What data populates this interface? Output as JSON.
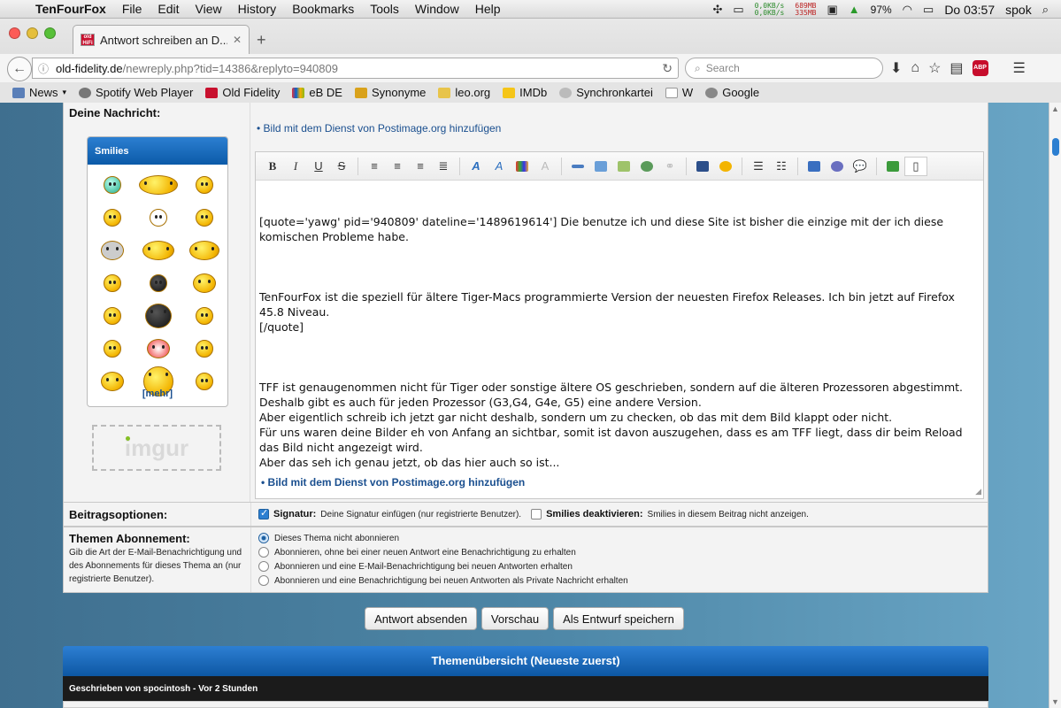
{
  "menubar": {
    "app_name": "TenFourFox",
    "items": [
      "File",
      "Edit",
      "View",
      "History",
      "Bookmarks",
      "Tools",
      "Window",
      "Help"
    ],
    "net_up": "0,0KB/s",
    "net_down": "0,0KB/s",
    "mem_used": "689MB",
    "mem_free": "335MB",
    "battery": "97%",
    "clock": "Do 03:57",
    "user": "spok"
  },
  "tab": {
    "favicon_text": "old HiFi",
    "title": "Antwort schreiben an D..."
  },
  "url": {
    "host": "old-fidelity.de",
    "path": "/newreply.php?tid=14386&replyto=940809"
  },
  "search": {
    "placeholder": "Search"
  },
  "abp_label": "ABP",
  "bookmarks": [
    "News",
    "Spotify Web Player",
    "Old Fidelity",
    "eB DE",
    "Synonyme",
    "leo.org",
    "IMDb",
    "Synchronkartei",
    "W",
    "Google"
  ],
  "form": {
    "message_label": "Deine Nachricht:",
    "smilies_title": "Smilies",
    "smilies_more": "[mehr]",
    "imgur_label": "imgur",
    "postimage_link": "Bild mit dem Dienst von Postimage.org hinzufügen",
    "postimage_link_bottom": "Bild mit dem Dienst von Postimage.org hinzufügen",
    "message_text": [
      "[quote='yawg' pid='940809' dateline='1489619614'] Die benutze ich und diese Site ist bisher die einzige mit der ich diese komischen Probleme habe.",
      "TenFourFox ist die speziell für ältere Tiger-Macs programmierte Version der neuesten Firefox Releases. Ich bin jetzt auf Firefox 45.8 Niveau.\n[/quote]",
      "TFF ist genaugenommen nicht für Tiger oder sonstige ältere OS geschrieben, sondern auf die älteren Prozessoren abgestimmt. Deshalb gibt es auch für jeden Prozessor (G3,G4, G4e, G5) eine andere Version.\nAber eigentlich schreib ich jetzt gar nicht deshalb, sondern um zu checken, ob das mit dem Bild klappt oder nicht.\nFür uns waren deine Bilder eh von Anfang an sichtbar, somit ist davon auszugehen, dass es am TFF liegt, dass dir beim Reload das Bild nicht angezeigt wird.\nAber das seh ich genau jetzt, ob das hier auch so ist..."
    ]
  },
  "options": {
    "label": "Beitragsoptionen:",
    "signature_bold": "Signatur:",
    "signature_text": "Deine Signatur einfügen (nur registrierte Benutzer).",
    "signature_checked": true,
    "smilies_bold": "Smilies deaktivieren:",
    "smilies_text": "Smilies in diesem Beitrag nicht anzeigen.",
    "smilies_checked": false
  },
  "subscription": {
    "label": "Themen Abonnement:",
    "description": "Gib die Art der E-Mail-Benachrichtigung und des Abonnements für dieses Thema an (nur registrierte Benutzer).",
    "choices": [
      "Dieses Thema nicht abonnieren",
      "Abonnieren, ohne bei einer neuen Antwort eine Benachrichtigung zu erhalten",
      "Abonnieren und eine E-Mail-Benachrichtigung bei neuen Antworten erhalten",
      "Abonnieren und eine Benachrichtigung bei neuen Antworten als Private Nachricht erhalten"
    ],
    "selected_index": 0
  },
  "buttons": {
    "submit": "Antwort absenden",
    "preview": "Vorschau",
    "draft": "Als Entwurf speichern"
  },
  "overview": {
    "title": "Themenübersicht (Neueste zuerst)",
    "first_post": "Geschrieben von spocintosh - Vor 2 Stunden"
  },
  "colors": {
    "accent_blue": "#0d57a3",
    "link_blue": "#1a4f8f"
  }
}
